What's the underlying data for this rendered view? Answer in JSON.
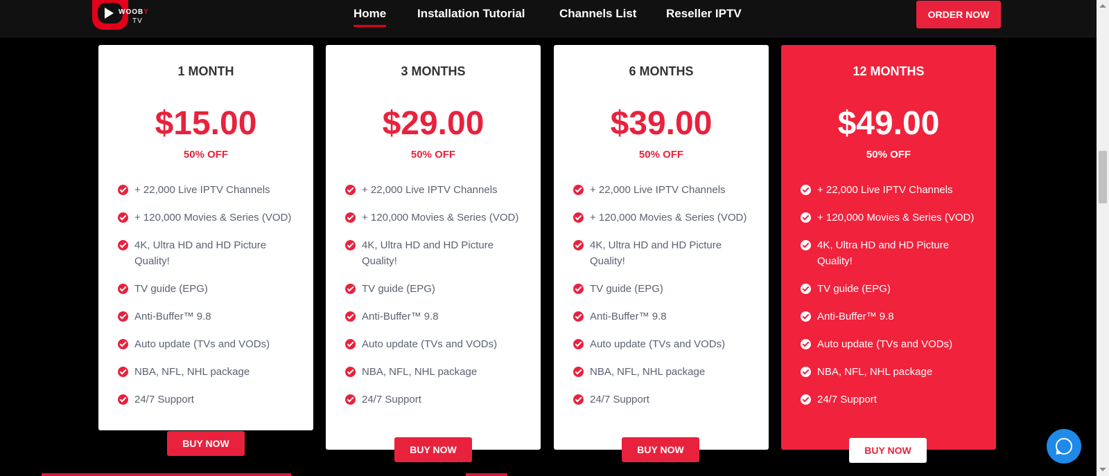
{
  "header": {
    "logo": {
      "text": "WOOB",
      "accent": "Y",
      "sub": "TV"
    },
    "nav": [
      {
        "label": "Home",
        "active": true
      },
      {
        "label": "Installation Tutorial",
        "active": false
      },
      {
        "label": "Channels List",
        "active": false
      },
      {
        "label": "Reseller IPTV",
        "active": false
      }
    ],
    "order_label": "ORDER NOW"
  },
  "plans": [
    {
      "name": "1 MONTH",
      "price": "$15.00",
      "discount": "50% OFF",
      "buy_label": "BUY NOW",
      "features": [
        "+ 22,000 Live IPTV Channels",
        "+ 120,000 Movies & Series (VOD)",
        "4K, Ultra HD and HD Picture Quality!",
        "TV guide (EPG)",
        "Anti-Buffer™ 9.8",
        "Auto update (TVs and VODs)",
        "NBA, NFL, NHL package",
        "24/7 Support"
      ]
    },
    {
      "name": "3 MONTHS",
      "price": "$29.00",
      "discount": "50% OFF",
      "buy_label": "BUY NOW",
      "features": [
        "+ 22,000 Live IPTV Channels",
        "+ 120,000 Movies & Series (VOD)",
        "4K, Ultra HD and HD Picture Quality!",
        "TV guide (EPG)",
        "Anti-Buffer™ 9.8",
        "Auto update (TVs and VODs)",
        "NBA, NFL, NHL package",
        "24/7 Support"
      ]
    },
    {
      "name": "6 MONTHS",
      "price": "$39.00",
      "discount": "50% OFF",
      "buy_label": "BUY NOW",
      "features": [
        "+ 22,000 Live IPTV Channels",
        "+ 120,000 Movies & Series (VOD)",
        "4K, Ultra HD and HD Picture Quality!",
        "TV guide (EPG)",
        "Anti-Buffer™ 9.8",
        "Auto update (TVs and VODs)",
        "NBA, NFL, NHL package",
        "24/7 Support"
      ]
    },
    {
      "name": "12 MONTHS",
      "price": "$49.00",
      "discount": "50% OFF",
      "buy_label": "BUY NOW",
      "features": [
        "+ 22,000 Live IPTV Channels",
        "+ 120,000 Movies & Series (VOD)",
        "4K, Ultra HD and HD Picture Quality!",
        "TV guide (EPG)",
        "Anti-Buffer™ 9.8",
        "Auto update (TVs and VODs)",
        "NBA, NFL, NHL package",
        "24/7 Support"
      ]
    }
  ],
  "colors": {
    "accent": "#e8223d",
    "featured_bg": "#f0223c",
    "whatsapp": "#1f8ae8",
    "header_bg": "#111111"
  },
  "icons": {
    "feature": "check-circle-icon",
    "chat": "whatsapp-icon"
  }
}
